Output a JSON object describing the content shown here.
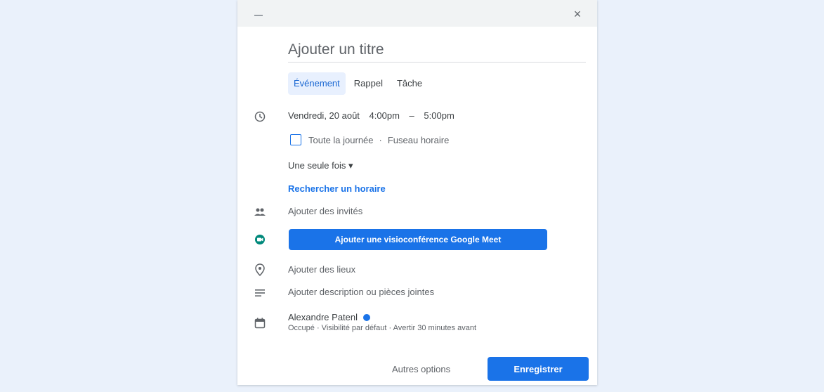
{
  "dialog": {
    "close_label": "×",
    "title_placeholder": "Ajouter un titre",
    "tabs": [
      {
        "label": "Événement",
        "active": true
      },
      {
        "label": "Rappel",
        "active": false
      },
      {
        "label": "Tâche",
        "active": false
      }
    ],
    "date": {
      "day": "Vendredi, 20 août",
      "start": "4:00pm",
      "dash": "–",
      "end": "5:00pm"
    },
    "all_day": {
      "label": "Toute la journée",
      "separator": "·",
      "timezone": "Fuseau horaire"
    },
    "repeat": "Une seule fois ▾",
    "find_time": "Rechercher un horaire",
    "guests": "Ajouter des invités",
    "meet_button": "Ajouter une visioconférence Google Meet",
    "location": "Ajouter des lieux",
    "description": "Ajouter description ou pièces jointes",
    "calendar": {
      "owner": "Alexandre Patenl",
      "details": "Occupé · Visibilité par défaut · Avertir 30 minutes avant",
      "color": "#1a73e8"
    },
    "footer": {
      "more_options": "Autres options",
      "save": "Enregistrer"
    }
  },
  "icons": {
    "clock": "clock-icon",
    "guests": "people-icon",
    "meet": "google-meet-icon",
    "location": "location-pin-icon",
    "description": "description-icon",
    "calendar": "calendar-icon"
  },
  "colors": {
    "accent": "#1a73e8",
    "background": "#eaf1fb",
    "tab_active_bg": "#e8f0fe"
  }
}
